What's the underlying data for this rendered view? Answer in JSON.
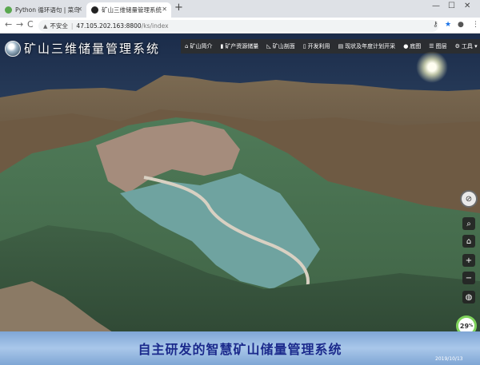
{
  "browser": {
    "tabs": [
      {
        "title": "Python 循环语句 | 菜鸟教程",
        "state": "inactive"
      },
      {
        "title": "矿山三维储量管理系统",
        "state": "active"
      }
    ],
    "new_tab_symbol": "+",
    "window_controls": [
      "—",
      "☐",
      "✕"
    ],
    "nav": {
      "back": "←",
      "forward": "→",
      "reload": "C"
    },
    "address": {
      "security_label": "不安全",
      "host": "47.105.202.163:8800",
      "path": "/ks/index"
    },
    "toolbar_icons": [
      "key-icon",
      "star-icon",
      "account-icon",
      "menu-icon"
    ]
  },
  "app": {
    "title": "矿山三维储量管理系统",
    "menu": [
      {
        "icon": "home-icon",
        "label": "矿山简介"
      },
      {
        "icon": "bookmark-icon",
        "label": "矿产资源储量"
      },
      {
        "icon": "chart-icon",
        "label": "矿山剖面"
      },
      {
        "icon": "file-icon",
        "label": "开发利用"
      },
      {
        "icon": "doc-icon",
        "label": "现状及年度计划开采"
      },
      {
        "icon": "globe-icon",
        "label": "底图"
      },
      {
        "icon": "layers-icon",
        "label": "图层"
      },
      {
        "icon": "gear-icon",
        "label": "工具 ▾"
      }
    ],
    "right_tools": [
      "compass-icon",
      "search-icon",
      "home-icon",
      "zoom-in-icon",
      "zoom-out-icon",
      "globe-icon"
    ],
    "load_percent": {
      "value": "29",
      "unit": "%"
    },
    "caption": "自主研发的智慧矿山储量管理系统",
    "timestamp": "2019/10/13"
  }
}
